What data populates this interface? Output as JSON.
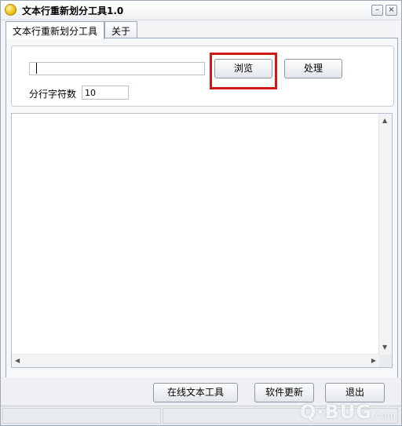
{
  "window": {
    "title": "文本行重新划分工具1.0",
    "minimize_symbol": "–",
    "close_symbol": "×"
  },
  "tabs": [
    {
      "label": "文本行重新划分工具",
      "active": true
    },
    {
      "label": "关于",
      "active": false
    }
  ],
  "toolbar": {
    "file_path_value": "",
    "browse_label": "浏览",
    "process_label": "处理",
    "highlight_color": "#d01818"
  },
  "settings": {
    "chars_per_line_label": "分行字符数",
    "chars_per_line_value": "10"
  },
  "output": {
    "text": ""
  },
  "footer": {
    "online_tool_label": "在线文本工具",
    "update_label": "软件更新",
    "exit_label": "退出"
  },
  "watermark": {
    "brand": "Q·BUG",
    "domain": ".com"
  },
  "colors": {
    "window_border": "#9aa7b6",
    "panel_bg": "#f7f8f9"
  }
}
